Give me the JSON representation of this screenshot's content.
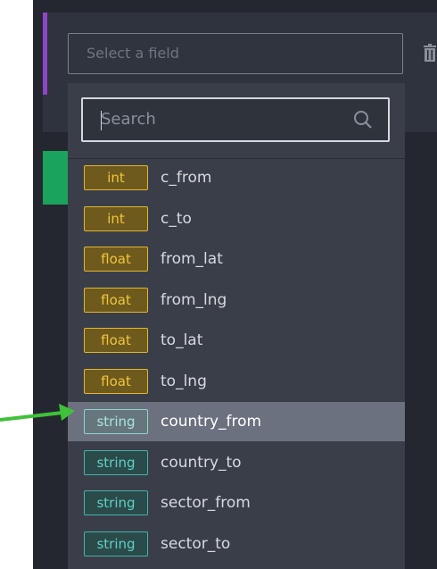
{
  "field_select": {
    "placeholder": "Select a field"
  },
  "search": {
    "placeholder": "Search"
  },
  "options": [
    {
      "type": "int",
      "name": "c_from"
    },
    {
      "type": "int",
      "name": "c_to"
    },
    {
      "type": "float",
      "name": "from_lat"
    },
    {
      "type": "float",
      "name": "from_lng"
    },
    {
      "type": "float",
      "name": "to_lat"
    },
    {
      "type": "float",
      "name": "to_lng"
    },
    {
      "type": "string",
      "name": "country_from",
      "selected": true
    },
    {
      "type": "string",
      "name": "country_to"
    },
    {
      "type": "string",
      "name": "sector_from"
    },
    {
      "type": "string",
      "name": "sector_to"
    }
  ],
  "colors": {
    "accent_purple": "#8f45c8",
    "accent_green": "#1aa35c",
    "numeric_badge": "#e2b731",
    "string_badge": "#45b3ab",
    "annotation_arrow": "#3fc23a"
  },
  "icons": {
    "delete": "trash-icon",
    "search": "search-icon"
  }
}
